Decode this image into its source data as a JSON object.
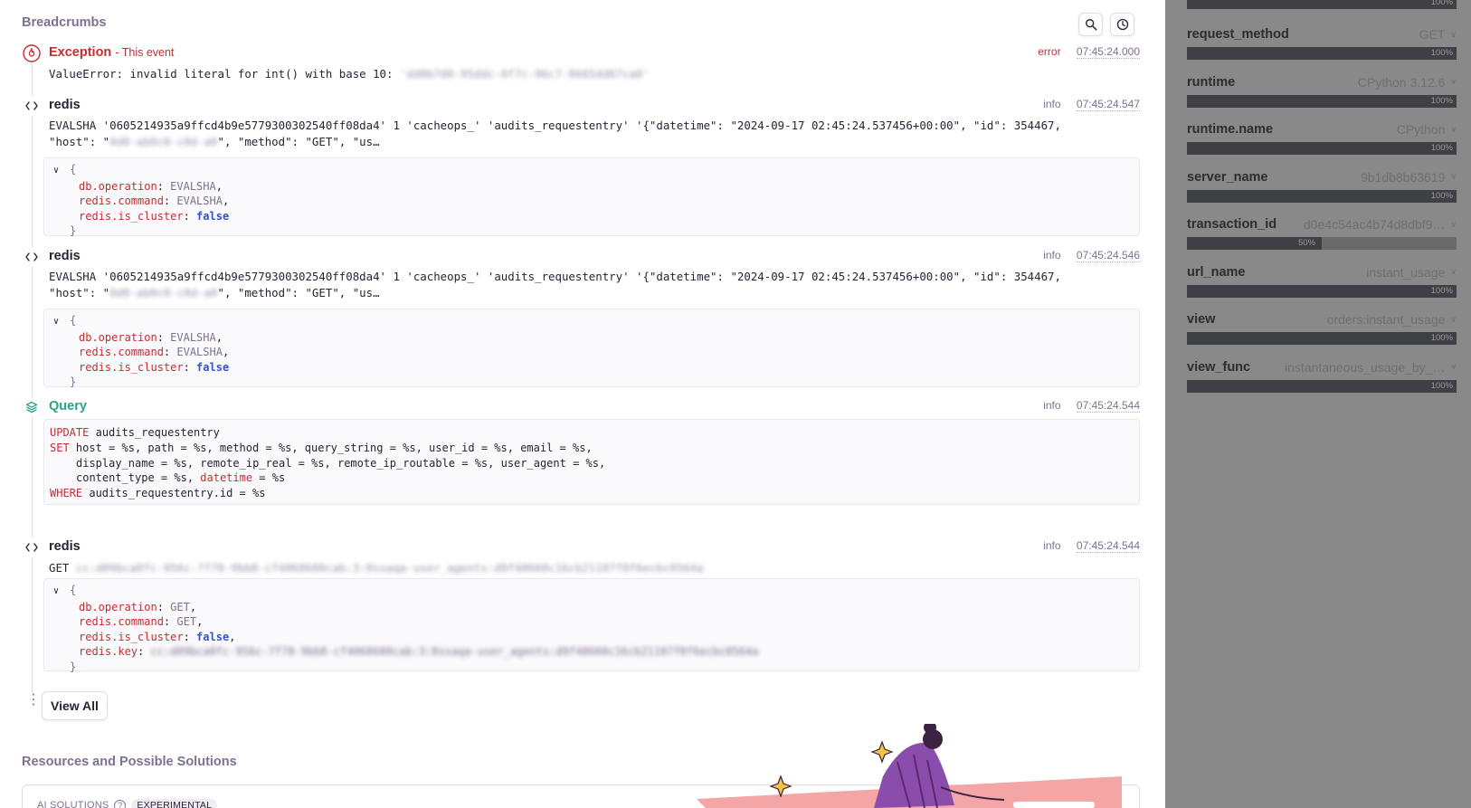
{
  "breadcrumbs": {
    "title": "Breadcrumbs",
    "view_all_label": "View All",
    "items": [
      {
        "category": "Exception",
        "subtitle": "- This event",
        "level": "error",
        "timestamp": "07:45:24.000",
        "message": "ValueError: invalid literal for int() with base 10: ",
        "message_redacted": "'dd0b7d0-95ddc-0f7c-96c7-8665dd07ca0'"
      },
      {
        "category": "redis",
        "level": "info",
        "timestamp": "07:45:24.547",
        "message_line1": "EVALSHA '0605214935a9ffcd4b9e5779300302540ff08da4' 1 'cacheops_' 'audits_requestentry' '{\"datetime\": \"2024-09-17 02:45:24.537456+00:00\", \"id\": 354467,",
        "message_line2_start": "\"host\": \"",
        "message_line2_redacted": "0d0-ab0c0-c0d-a0",
        "message_line2_end": "\", \"method\": \"GET\", \"us…",
        "data": {
          "open": "{",
          "close": "}",
          "k1": "db.operation",
          "v1": "EVALSHA",
          "k2": "redis.command",
          "v2": "EVALSHA",
          "k3": "redis.is_cluster",
          "v3": "false"
        }
      },
      {
        "category": "redis",
        "level": "info",
        "timestamp": "07:45:24.546",
        "message_line1": "EVALSHA '0605214935a9ffcd4b9e5779300302540ff08da4' 1 'cacheops_' 'audits_requestentry' '{\"datetime\": \"2024-09-17 02:45:24.537456+00:00\", \"id\": 354467,",
        "message_line2_start": "\"host\": \"",
        "message_line2_redacted": "0d0-ab0c0-c0d-a0",
        "message_line2_end": "\", \"method\": \"GET\", \"us…",
        "data": {
          "open": "{",
          "close": "}",
          "k1": "db.operation",
          "v1": "EVALSHA",
          "k2": "redis.command",
          "v2": "EVALSHA",
          "k3": "redis.is_cluster",
          "v3": "false"
        }
      },
      {
        "category": "Query",
        "level": "info",
        "timestamp": "07:45:24.544",
        "sql": {
          "update_kw": "UPDATE",
          "table": "audits_requestentry",
          "set_kw": "SET",
          "l2": "host = %s, path = %s, method = %s, query_string = %s, user_id = %s, email = %s,",
          "l3": "display_name = %s, remote_ip_real = %s, remote_ip_routable = %s, user_agent = %s,",
          "l4a": "content_type = %s, ",
          "l4kw": "datetime",
          "l4b": " = %s",
          "where_kw": "WHERE",
          "l5": "audits_requestentry.id = %s"
        }
      },
      {
        "category": "redis",
        "level": "info",
        "timestamp": "07:45:24.544",
        "message_start": "GET ",
        "message_redacted": "cc:d09bca0fc-956c-7f78-9bb8-cf4068680cab:3:0ssaqa-user_agents:d9f48660c16cb21107f0f6ecbc0564a",
        "data": {
          "open": "{",
          "close": "}",
          "k1": "db.operation",
          "v1": "GET",
          "k2": "redis.command",
          "v2": "GET",
          "k3": "redis.is_cluster",
          "v3": "false",
          "k4": "redis.key",
          "v4": "cc:d09bca0fc-956c-7f78-9bb8-cf4068680cab:3:0ssaqa-user_agents:d9f48660c16cb21107f0f6ecbc0564a"
        }
      }
    ]
  },
  "resources": {
    "title": "Resources and Possible Solutions",
    "ai_label": "AI SOLUTIONS",
    "help": "?",
    "badge": "EXPERIMENTAL"
  },
  "tags": {
    "top_pct": "100%",
    "items": [
      {
        "key": "request_method",
        "value": "GET",
        "pct": "100%",
        "fill": 1.0
      },
      {
        "key": "runtime",
        "value": "CPython 3.12.6",
        "pct": "100%",
        "fill": 1.0
      },
      {
        "key": "runtime.name",
        "value": "CPython",
        "pct": "100%",
        "fill": 1.0
      },
      {
        "key": "server_name",
        "value": "9b1db8b63619",
        "pct": "100%",
        "fill": 1.0
      },
      {
        "key": "transaction_id",
        "value": "d0e4c54ac4b74d8dbf9…",
        "pct": "50%",
        "fill": 0.5
      },
      {
        "key": "url_name",
        "value": "instant_usage",
        "pct": "100%",
        "fill": 1.0
      },
      {
        "key": "view",
        "value": "orders:instant_usage",
        "pct": "100%",
        "fill": 1.0
      },
      {
        "key": "view_func",
        "value": "instantaneous_usage_by_…",
        "pct": "100%",
        "fill": 1.0
      }
    ]
  },
  "colors": {
    "error": "#c42d31",
    "query": "#2ba185",
    "muted": "#80708f",
    "overlay": "#898989"
  }
}
